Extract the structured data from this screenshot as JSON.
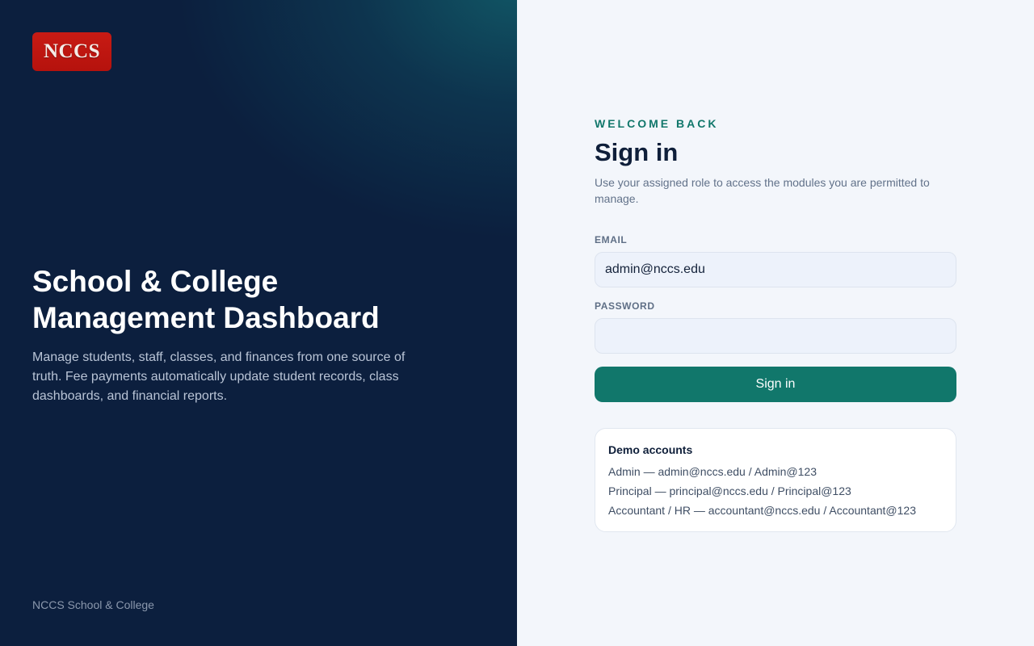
{
  "hero": {
    "logo_text": "NCCS",
    "title_line1": "School & College",
    "title_line2": "Management Dashboard",
    "description": "Manage students, staff, classes, and finances from one source of truth. Fee payments automatically update student records, class dashboards, and financial reports.",
    "footer": "NCCS School & College"
  },
  "form": {
    "eyebrow": "WELCOME BACK",
    "title": "Sign in",
    "subtitle": "Use your assigned role to access the modules you are permitted to manage.",
    "email_label": "EMAIL",
    "email_value": "admin@nccs.edu",
    "password_label": "PASSWORD",
    "password_value": "",
    "submit_label": "Sign in"
  },
  "demo": {
    "title": "Demo accounts",
    "accounts": [
      "Admin — admin@nccs.edu / Admin@123",
      "Principal — principal@nccs.edu / Principal@123",
      "Accountant / HR — accountant@nccs.edu / Accountant@123"
    ]
  },
  "colors": {
    "hero_bg": "#0c1f3e",
    "accent": "#11776b",
    "logo_red": "#b5120d",
    "panel_bg": "#f3f6fb"
  }
}
